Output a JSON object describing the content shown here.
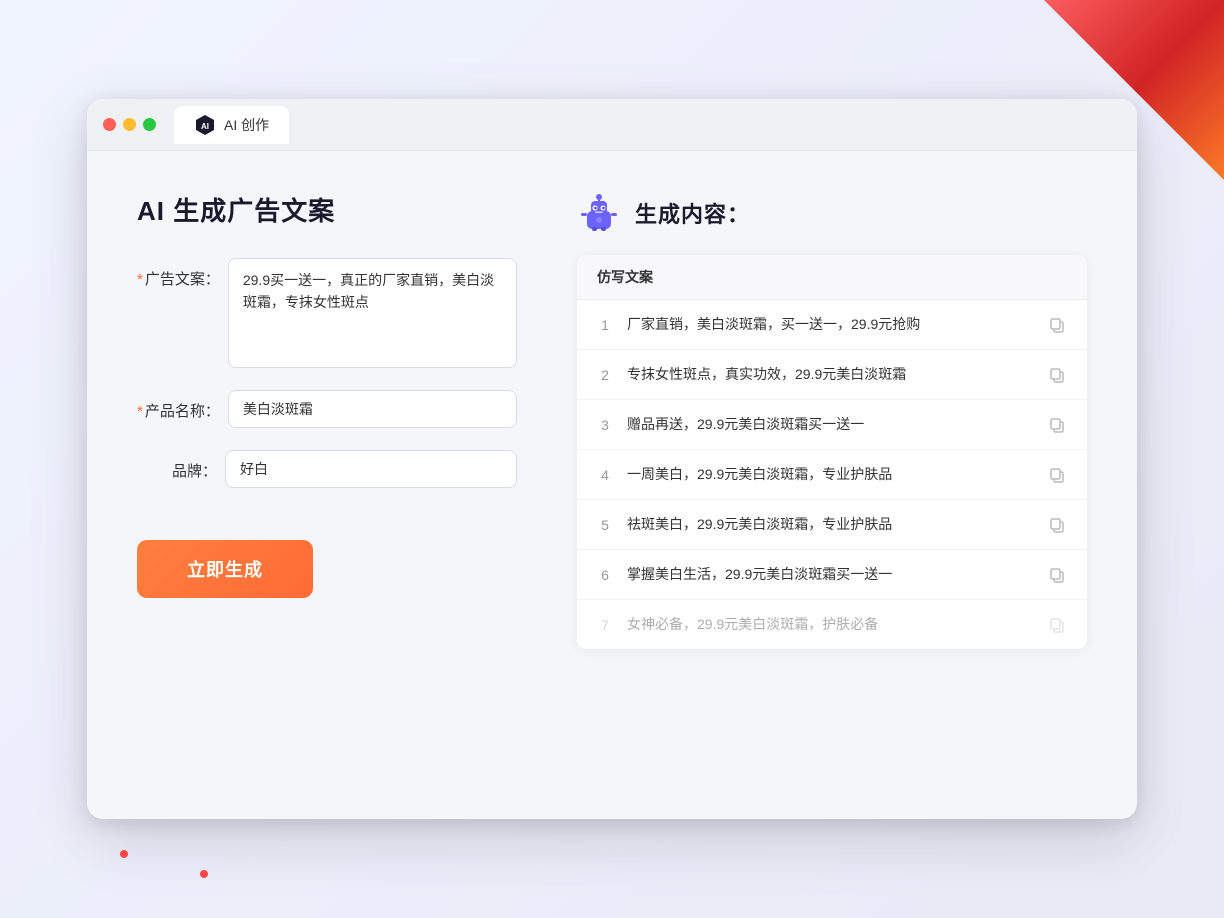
{
  "window": {
    "title": "AI 创作",
    "tab_label": "AI 创作"
  },
  "traffic_lights": {
    "red": "close",
    "yellow": "minimize",
    "green": "maximize"
  },
  "left_panel": {
    "title": "AI 生成广告文案",
    "form": {
      "ad_copy_label": "广告文案：",
      "ad_copy_required": "＊",
      "ad_copy_value": "29.9买一送一，真正的厂家直销，美白淡斑霜，专抹女性斑点",
      "product_name_label": "产品名称：",
      "product_name_required": "＊",
      "product_name_value": "美白淡斑霜",
      "brand_label": "品牌：",
      "brand_value": "好白",
      "generate_btn": "立即生成"
    }
  },
  "right_panel": {
    "title": "生成内容：",
    "table_header": "仿写文案",
    "results": [
      {
        "num": "1",
        "text": "厂家直销，美白淡斑霜，买一送一，29.9元抢购"
      },
      {
        "num": "2",
        "text": "专抹女性斑点，真实功效，29.9元美白淡斑霜"
      },
      {
        "num": "3",
        "text": "赠品再送，29.9元美白淡斑霜买一送一"
      },
      {
        "num": "4",
        "text": "一周美白，29.9元美白淡斑霜，专业护肤品"
      },
      {
        "num": "5",
        "text": "祛斑美白，29.9元美白淡斑霜，专业护肤品"
      },
      {
        "num": "6",
        "text": "掌握美白生活，29.9元美白淡斑霜买一送一"
      },
      {
        "num": "7",
        "text": "女神必备，29.9元美白淡斑霜，护肤必备",
        "faded": true
      }
    ]
  }
}
